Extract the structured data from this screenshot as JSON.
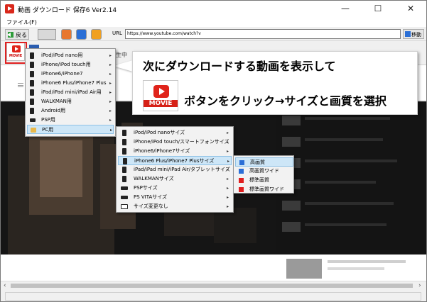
{
  "window": {
    "title": "動画 ダウンロード 保存6 Ver2.14",
    "minimize": "—",
    "maximize": "☐",
    "close": "✕"
  },
  "menubar": {
    "file": "ファイル(F)"
  },
  "toolbar": {
    "back_label": "戻る",
    "url_label": "URL",
    "url_value": "https://www.youtube.com/watch?v",
    "go_label": "移動"
  },
  "toolbar2": {
    "movie_label": "MOVIE",
    "tab_text": "生中"
  },
  "device_menu": {
    "items": [
      {
        "label": "iPod/iPod nano用",
        "submenu": "▸"
      },
      {
        "label": "iPhone/iPod touch用",
        "submenu": "▸"
      },
      {
        "label": "iPhone6/iPhone7",
        "submenu": "▸"
      },
      {
        "label": "iPhone6 Plus/iPhone7 Plus",
        "submenu": "▸"
      },
      {
        "label": "iPad/iPad mini/iPad Air用",
        "submenu": "▸"
      },
      {
        "label": "WALKMAN用",
        "submenu": "▸"
      },
      {
        "label": "Android用",
        "submenu": "▸"
      },
      {
        "label": "PSP用",
        "submenu": "▸"
      },
      {
        "label": "PC用",
        "submenu": "▸"
      }
    ]
  },
  "pc_menu": {
    "items": [
      {
        "label": "iPod/iPod nanoサイズ",
        "submenu": "▸"
      },
      {
        "label": "iPhone/iPod touch/スマートフォンサイズ",
        "submenu": "▸"
      },
      {
        "label": "iPhone6/iPhone7サイズ",
        "submenu": "▸"
      },
      {
        "label": "iPhone6 Plus/iPhone7 Plusサイズ",
        "submenu": "▸"
      },
      {
        "label": "iPad/iPad mini/iPad Air/タブレットサイズ",
        "submenu": "▸"
      },
      {
        "label": "WALKMANサイズ",
        "submenu": "▸"
      },
      {
        "label": "PSPサイズ",
        "submenu": "▸"
      },
      {
        "label": "PS VITAサイズ",
        "submenu": "▸"
      },
      {
        "label": "サイズ変更なし",
        "submenu": "▸"
      }
    ]
  },
  "quality_menu": {
    "items": [
      {
        "label": "高画質",
        "color": "#2b6fd6"
      },
      {
        "label": "高画質ワイド",
        "color": "#2b6fd6"
      },
      {
        "label": "標準画質",
        "color": "#e02020"
      },
      {
        "label": "標準画質ワイド",
        "color": "#e02020"
      }
    ]
  },
  "callout": {
    "line1": "次にダウンロードする動画を表示して",
    "movie_label": "MOVIE",
    "line2": "ボタンをクリック→サイズと画質を選択"
  },
  "scroll": {
    "left": "‹",
    "right": "›"
  },
  "colors": {
    "highlight": "#e02020",
    "selected": "#cde6f7"
  }
}
